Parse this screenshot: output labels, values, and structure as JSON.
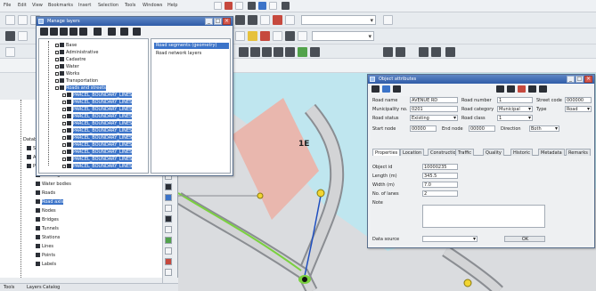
{
  "menubar": {
    "items": [
      "File",
      "Edit",
      "View",
      "Bookmarks",
      "Insert",
      "Selection",
      "Tools",
      "Windows",
      "Help"
    ]
  },
  "layers_window": {
    "title": "Manage layers",
    "controls": [
      "_",
      "□",
      "×"
    ],
    "tree": [
      {
        "label": "Base",
        "selected": false
      },
      {
        "label": "Administrative",
        "selected": false
      },
      {
        "label": "Cadastre",
        "selected": false
      },
      {
        "label": "Water",
        "selected": false
      },
      {
        "label": "Works",
        "selected": false
      },
      {
        "label": "Transportation",
        "selected": false
      },
      {
        "label": "Roads and streets",
        "selected": true
      },
      {
        "label": "PARCEL_BOUNDARY_LINES",
        "selected": true
      },
      {
        "label": "PARCEL_BOUNDARY_LINES",
        "selected": true
      },
      {
        "label": "PARCEL_BOUNDARY_LINES",
        "selected": true
      },
      {
        "label": "PARCEL_BOUNDARY_LINES",
        "selected": true
      },
      {
        "label": "PARCEL_BOUNDARY_LINES",
        "selected": true
      },
      {
        "label": "PARCEL_BOUNDARY_LINES",
        "selected": true
      },
      {
        "label": "PARCEL_BOUNDARY_LINES",
        "selected": true
      },
      {
        "label": "PARCEL_BOUNDARY_LINES",
        "selected": true
      },
      {
        "label": "PARCEL_BOUNDARY_LINES",
        "selected": true
      },
      {
        "label": "PARCEL_BOUNDARY_LINES",
        "selected": true
      },
      {
        "label": "PARCEL_BOUNDARY_LINES",
        "selected": true
      }
    ],
    "list": [
      {
        "label": "Road segments (geometry)",
        "selected": true
      },
      {
        "label": "Road network layers",
        "selected": false
      }
    ]
  },
  "toc": {
    "header": "Database",
    "items": [
      {
        "label": "Streets",
        "selected": false
      },
      {
        "label": "Addresses",
        "selected": false
      },
      {
        "label": "Parcels",
        "selected": false
      },
      {
        "label": "Buildings",
        "selected": false
      },
      {
        "label": "Water bodies",
        "selected": false
      },
      {
        "label": "Roads",
        "selected": false
      },
      {
        "label": "Road axis",
        "selected": true
      },
      {
        "label": "Nodes",
        "selected": false
      },
      {
        "label": "Bridges",
        "selected": false
      },
      {
        "label": "Tunnels",
        "selected": false
      },
      {
        "label": "Stations",
        "selected": false
      },
      {
        "label": "Lines",
        "selected": false
      },
      {
        "label": "Points",
        "selected": false
      },
      {
        "label": "Labels",
        "selected": false
      }
    ]
  },
  "attr_window": {
    "title": "Object attributes",
    "controls": [
      "_",
      "□",
      "×"
    ],
    "top_fields": [
      {
        "label": "Road name",
        "value": "AVENUE RD"
      },
      {
        "label": "Road number",
        "value": "1"
      },
      {
        "label": "Municipality no.",
        "value": "0201"
      },
      {
        "label": "Road category",
        "value": "Municipal"
      },
      {
        "label": "Road status",
        "value": "Existing"
      },
      {
        "label": "Road class",
        "value": "1"
      }
    ],
    "right_fields": [
      {
        "label": "Street code",
        "value": "000000"
      },
      {
        "label": "Type",
        "value": "Road"
      }
    ],
    "row3": [
      {
        "label": "Start node",
        "value": "00000"
      },
      {
        "label": "End node",
        "value": "00000"
      },
      {
        "label": "Direction",
        "value": "Both"
      }
    ],
    "tabs": [
      "Properties",
      "Location",
      "Construction",
      "Traffic",
      "Quality",
      "Historic",
      "Metadata",
      "Remarks"
    ],
    "active_tab": "Properties",
    "form": [
      {
        "label": "Object id",
        "value": "10000235"
      },
      {
        "label": "Length (m)",
        "value": "345.5"
      },
      {
        "label": "Width (m)",
        "value": "7.0"
      },
      {
        "label": "No. of lanes",
        "value": "2"
      },
      {
        "label": "Note",
        "value": ""
      }
    ],
    "bottom_label": "Data source",
    "bottom_value": "",
    "ok_label": "OK"
  },
  "map": {
    "label": "1E",
    "colors": {
      "water": "#bfe6ef",
      "land": "#dadcdf",
      "parcel": "#e9b7ae",
      "road": "#d3d4d6",
      "road_edge": "#8a8d92",
      "selected_line": "#7ad13e",
      "blue_line": "#1f4fbf",
      "node": "#f2d531"
    }
  },
  "statusbar": {
    "left": "Tools",
    "right": "Layers   Catalog"
  }
}
